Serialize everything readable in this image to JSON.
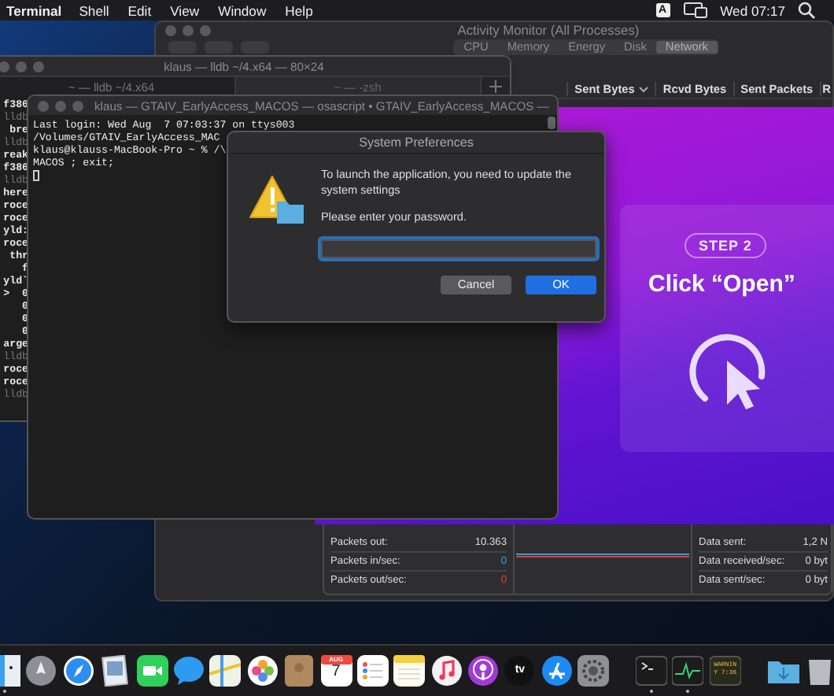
{
  "menu_bar": {
    "app": "Terminal",
    "menus": [
      "Shell",
      "Edit",
      "View",
      "Window",
      "Help"
    ],
    "input_source": "A",
    "clock": "Wed 07:17"
  },
  "activity_monitor": {
    "title": "Activity Monitor (All Processes)",
    "tabs": [
      {
        "label": "CPU",
        "selected": false
      },
      {
        "label": "Memory",
        "selected": false
      },
      {
        "label": "Energy",
        "selected": false
      },
      {
        "label": "Disk",
        "selected": false
      },
      {
        "label": "Network",
        "selected": true
      }
    ],
    "columns": [
      {
        "label": "Sent Bytes",
        "sorted": true
      },
      {
        "label": "Rcvd Bytes",
        "sorted": false
      },
      {
        "label": "Sent Packets",
        "sorted": false
      },
      {
        "label": "R",
        "sorted": false
      }
    ],
    "stats_left": [
      {
        "label": "Packets out:",
        "value": "10.363",
        "color": "#dcdcdc"
      },
      {
        "label": "Packets in/sec:",
        "value": "0",
        "color": "#3b9be0"
      },
      {
        "label": "Packets out/sec:",
        "value": "0",
        "color": "#e0403a"
      }
    ],
    "stats_right": [
      {
        "label": "Data sent:",
        "value": "1,2 N"
      },
      {
        "label": "Data received/sec:",
        "value": "0 byt"
      },
      {
        "label": "Data sent/sec:",
        "value": "0 byt"
      }
    ]
  },
  "promo": {
    "badge": "STEP 2",
    "heading": "Click “Open”"
  },
  "terminal_back": {
    "title": "klaus — lldb ~/4.x64 — 80×24",
    "tabs": [
      {
        "label": "~ — lldb ~/4.x64",
        "selected": true
      },
      {
        "label": "~ — -zsh",
        "selected": false
      }
    ],
    "lines": [
      {
        "text": "f386",
        "dim": false
      },
      {
        "text": "lldb",
        "dim": true
      },
      {
        "text": "bre",
        "dim": false
      },
      {
        "text": "lldb",
        "dim": true
      },
      {
        "text": "reak",
        "dim": false
      },
      {
        "text": "f386",
        "dim": false
      },
      {
        "text": "lldb",
        "dim": true
      },
      {
        "text": "here",
        "dim": false
      },
      {
        "text": "roce",
        "dim": false
      },
      {
        "text": "roce",
        "dim": false
      },
      {
        "text": "yld:",
        "dim": false
      },
      {
        "text": "roce",
        "dim": false
      },
      {
        "text": "thr",
        "dim": false
      },
      {
        "text": "f",
        "dim": false
      },
      {
        "text": "yld`",
        "dim": false
      },
      {
        "text": ">  0",
        "dim": false
      },
      {
        "text": "0",
        "dim": false
      },
      {
        "text": "0",
        "dim": false
      },
      {
        "text": "0",
        "dim": false
      },
      {
        "text": "arge",
        "dim": false
      },
      {
        "text": "lldb",
        "dim": true
      },
      {
        "text": "roce",
        "dim": false
      },
      {
        "text": "roce",
        "dim": false
      },
      {
        "text": "lldb",
        "dim": true
      }
    ]
  },
  "terminal_front": {
    "title": "klaus — GTAIV_EarlyAccess_MACOS — osascript • GTAIV_EarlyAccess_MACOS —",
    "lines": [
      "Last login: Wed Aug  7 07:03:37 on ttys003",
      "/Volumes/GTAIV_EarlyAccess_MAC",
      "klaus@klauss-MacBook-Pro ~ % /\\",
      "MACOS ; exit;"
    ]
  },
  "dialog": {
    "title": "System Preferences",
    "message": "To launch the application, you need to update the system settings",
    "prompt": "Please enter your password.",
    "password_field": {
      "focused": true
    },
    "buttons": [
      {
        "label": "Cancel",
        "default": false
      },
      {
        "label": "OK",
        "default": true
      }
    ]
  },
  "dock": {
    "items": [
      {
        "kind": "finder",
        "running": true
      },
      {
        "kind": "launchpad",
        "running": false
      },
      {
        "kind": "safari",
        "running": false
      },
      {
        "kind": "preview",
        "running": false
      },
      {
        "kind": "facetime",
        "running": false
      },
      {
        "kind": "messages",
        "running": false
      },
      {
        "kind": "maps",
        "running": false
      },
      {
        "kind": "photos",
        "running": false
      },
      {
        "kind": "contacts",
        "running": false
      },
      {
        "kind": "calendar",
        "running": false,
        "texts": [
          "AUG",
          "7"
        ]
      },
      {
        "kind": "reminders",
        "running": false
      },
      {
        "kind": "notes",
        "running": false
      },
      {
        "kind": "music",
        "running": false
      },
      {
        "kind": "podcasts",
        "running": false
      },
      {
        "kind": "tv",
        "running": false,
        "texts": [
          "tv"
        ]
      },
      {
        "kind": "appstore",
        "running": false
      },
      {
        "kind": "settings",
        "running": false
      },
      {
        "kind": "divider"
      },
      {
        "kind": "terminal",
        "running": true
      },
      {
        "kind": "activity",
        "running": true
      },
      {
        "kind": "console",
        "running": false,
        "texts": [
          "WARNIN",
          "Y 7:36"
        ]
      },
      {
        "kind": "divider"
      },
      {
        "kind": "downloads",
        "running": false
      },
      {
        "kind": "trash",
        "running": false
      }
    ]
  }
}
